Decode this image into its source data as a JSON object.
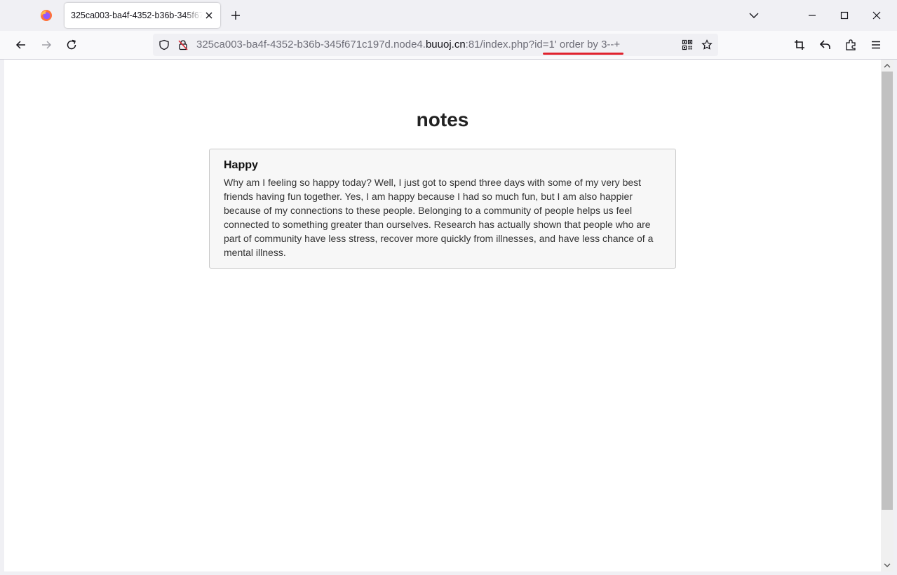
{
  "browser": {
    "tab_title": "325ca003-ba4f-4352-b36b-345f671c197d.node4.buuoj.cn:81/index.php?id=1' order by 3--+",
    "url_prefix": "325ca003-ba4f-4352-b36b-345f671c197d.node4.",
    "url_host": "buuoj.cn",
    "url_suffix": ":81/index.php?id=1' order by 3--+",
    "icons": [
      "firefox-logo",
      "tab-close-icon",
      "new-tab-icon",
      "list-all-tabs-icon",
      "minimize-icon",
      "maximize-icon",
      "close-window-icon",
      "back-icon",
      "forward-icon",
      "reload-icon",
      "shield-icon",
      "insecure-lock-icon",
      "qr-code-icon",
      "bookmark-star-icon",
      "crop-icon",
      "undo-icon",
      "extensions-icon",
      "menu-icon"
    ],
    "accent_color": "#e0232e"
  },
  "page": {
    "heading": "notes",
    "note": {
      "title": "Happy",
      "body": "Why am I feeling so happy today? Well, I just got to spend three days with some of my very best friends having fun together. Yes, I am happy because I had so much fun, but I am also happier because of my connections to these people. Belonging to a community of people helps us feel connected to something greater than ourselves. Research has actually shown that people who are part of community have less stress, recover more quickly from illnesses, and have less chance of a mental illness."
    }
  }
}
